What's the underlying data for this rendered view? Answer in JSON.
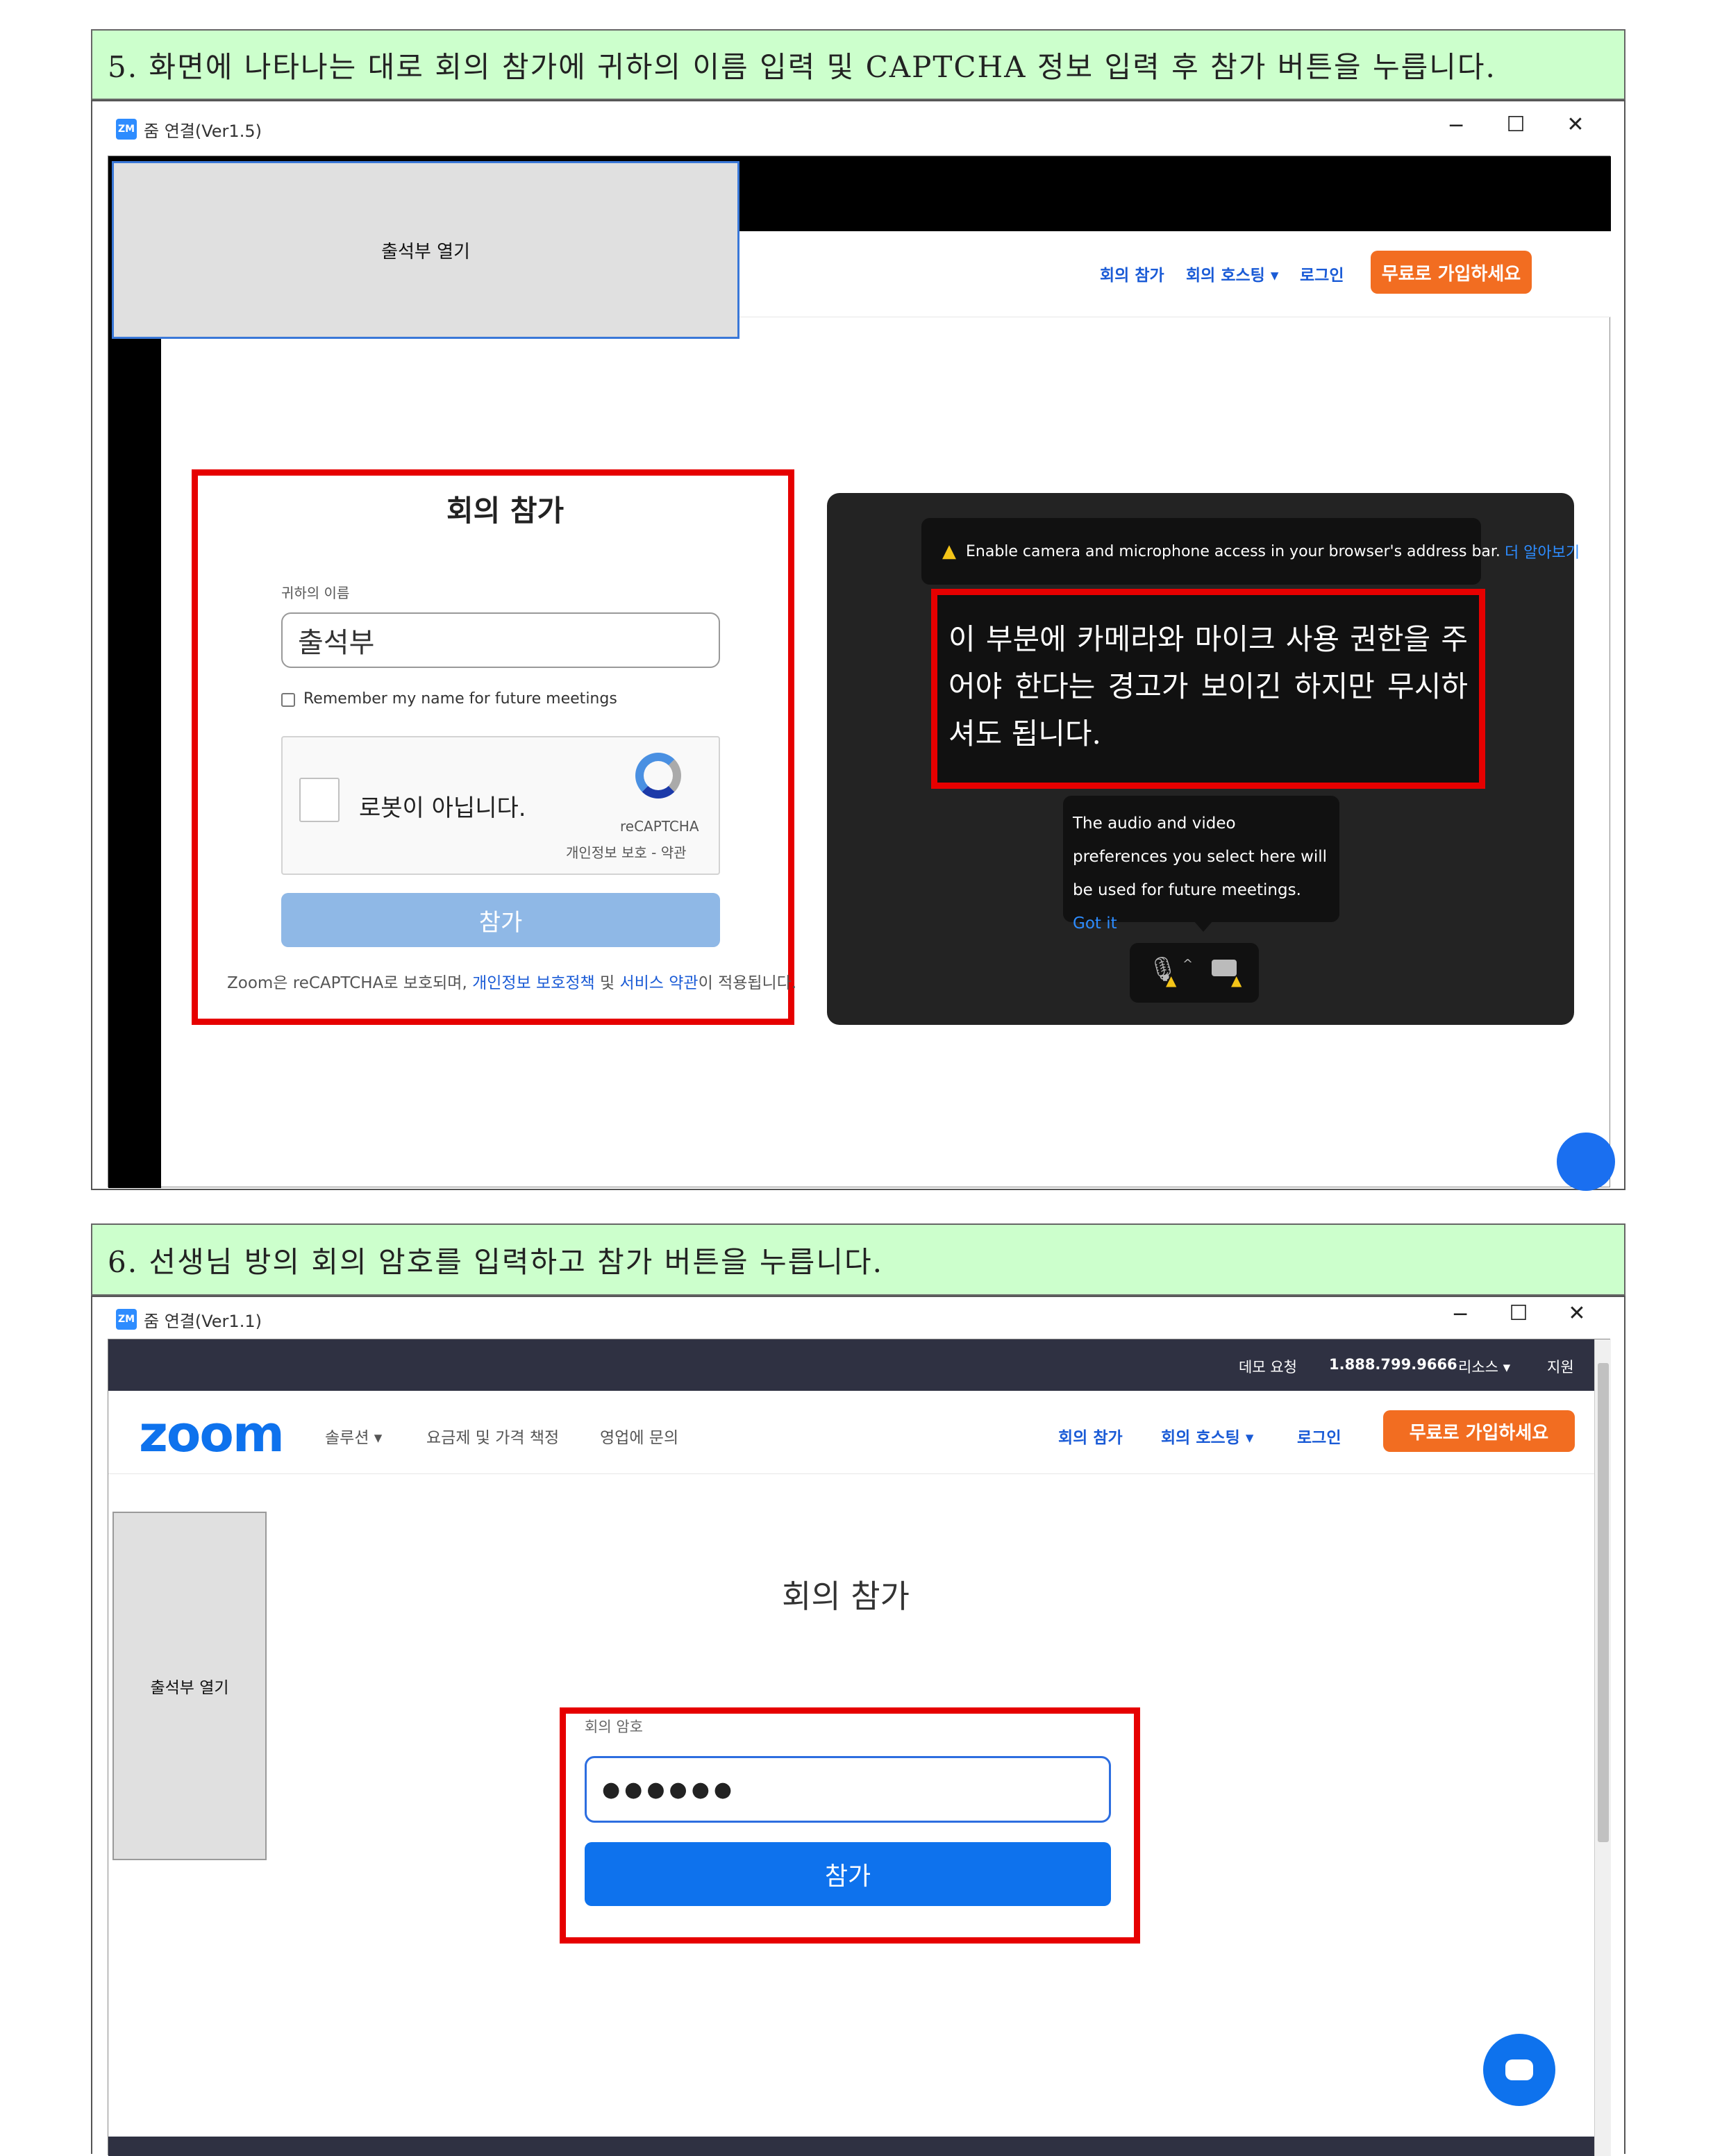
{
  "step5": {
    "header": "5. 화면에 나타나는 대로 회의 참가에 귀하의 이름 입력 및 CAPTCHA 정보 입력 후 참가 버튼을 누릅니다.",
    "window_title": "줌 연결(Ver1.5)",
    "app_icon": "ZM",
    "attendance_button": "출석부 열기",
    "nav": {
      "join": "회의 참가",
      "host": "회의 호스팅 ▾",
      "login": "로그인",
      "signup": "무료로 가입하세요"
    },
    "form": {
      "title": "회의 참가",
      "name_label": "귀하의 이름",
      "name_value": "출석부",
      "remember_label": "Remember my name for future meetings",
      "captcha_label": "로봇이 아닙니다.",
      "captcha_brand": "reCAPTCHA",
      "captcha_links": "개인정보 보호 - 약관",
      "join_button": "참가",
      "footer_prefix": "Zoom은 reCAPTCHA로 보호되며, ",
      "footer_privacy": "개인정보 보호정책",
      "footer_mid": " 및 ",
      "footer_terms": "서비스 약관",
      "footer_suffix": "이 적용됩니다."
    },
    "preview": {
      "warning_text": "Enable camera and microphone access in your browser's address bar.",
      "warning_link": "더 알아보기",
      "annotation": "이 부분에 카메라와 마이크 사용 권한을 주어야 한다는 경고가 보이긴 하지만 무시하셔도 됩니다.",
      "tooltip_text": "The audio and video preferences you select here will be used for future meetings.",
      "tooltip_link": "Got it"
    }
  },
  "step6": {
    "header": "6. 선생님 방의 회의 암호를 입력하고 참가 버튼을 누릅니다.",
    "window_title": "줌 연결(Ver1.1)",
    "app_icon": "ZM",
    "topbar": {
      "demo": "데모 요청",
      "phone": "1.888.799.9666",
      "resources": "리소스 ▾",
      "support": "지원"
    },
    "logo": "zoom",
    "nav_left": {
      "solutions": "솔루션 ▾",
      "pricing": "요금제 및 가격 책정",
      "sales": "영업에 문의"
    },
    "nav": {
      "join": "회의 참가",
      "host": "회의 호스팅 ▾",
      "login": "로그인",
      "signup": "무료로 가입하세요"
    },
    "attendance_button": "출석부 열기",
    "title": "회의 참가",
    "password_label": "회의 암호",
    "password_value": "●●●●●●",
    "join_button": "참가"
  },
  "colors": {
    "header_bg": "#ccffcc",
    "highlight": "#e60000",
    "zoom_blue": "#0e72ed",
    "signup_orange": "#f26d21"
  }
}
